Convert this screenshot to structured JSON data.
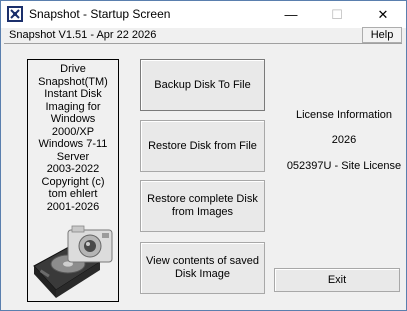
{
  "window": {
    "title": "Snapshot - Startup Screen",
    "controls": {
      "minimize": "—",
      "maximize": "☐",
      "close": "✕"
    }
  },
  "header": {
    "version": "Snapshot V1.51 - Apr 22 2026",
    "help_label": "Help"
  },
  "info_panel": {
    "lines": [
      "Drive",
      "Snapshot(TM)",
      "Instant Disk",
      "Imaging for",
      "Windows",
      "2000/XP",
      "Windows 7-11",
      "Server",
      "2003-2022",
      "Copyright (c)",
      "tom ehlert",
      "2001-2026"
    ]
  },
  "actions": {
    "backup": "Backup Disk To File",
    "restore": "Restore Disk from File",
    "restore_images": "Restore complete Disk from Images",
    "view": "View contents of saved Disk Image"
  },
  "license": {
    "label": "License Information",
    "year": "2026",
    "key": "052397U - Site License"
  },
  "exit_label": "Exit",
  "icons": {
    "app": "snapshot-app-icon",
    "camera": "camera-icon",
    "disk": "hard-disk-icon"
  }
}
